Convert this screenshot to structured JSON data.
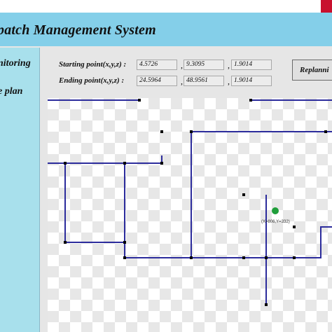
{
  "window": {
    "title": "patch Management System"
  },
  "sidebar": {
    "items": [
      {
        "label": "nitoring"
      },
      {
        "label": "e plan"
      }
    ]
  },
  "form": {
    "start": {
      "label": "Starting point(x,y,z) :",
      "x": "4.5726",
      "y": "9.3095",
      "z": "1.9014"
    },
    "end": {
      "label": "Ending point(x,y,z) :",
      "x": "24.5964",
      "y": "48.9561",
      "z": "1.9014"
    },
    "separator": ","
  },
  "toolbar": {
    "replan_label": "Replanni"
  },
  "map": {
    "coordinate_readout": "(X=806,Y=332)",
    "colors": {
      "path": "#2c2c9c",
      "node": "#000000",
      "marker": "#1f9e3a",
      "checker_light": "#ffffff",
      "checker_dark": "#e7e7e7"
    }
  }
}
